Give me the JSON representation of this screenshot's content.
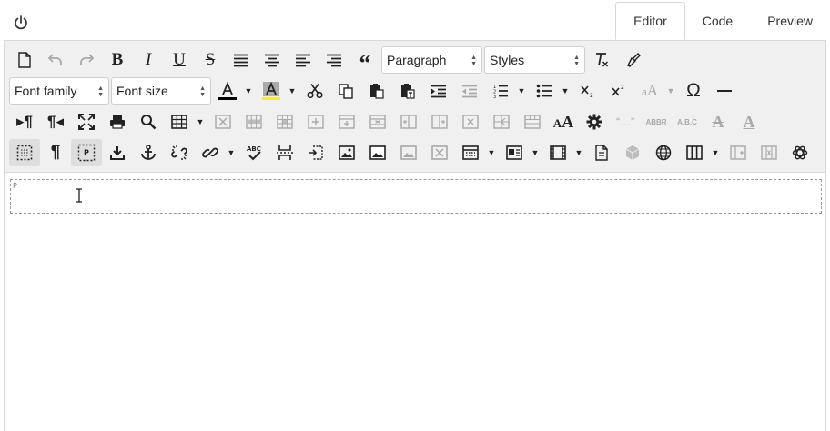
{
  "tabs": [
    {
      "label": "Editor",
      "active": true
    },
    {
      "label": "Code",
      "active": false
    },
    {
      "label": "Preview",
      "active": false
    }
  ],
  "toolbar": {
    "paragraph_select": "Paragraph",
    "styles_select": "Styles",
    "font_family_select": "Font family",
    "font_size_select": "Font size",
    "colors": {
      "text_color": "#000000",
      "highlight_color": "#f5e84a"
    }
  },
  "content": {
    "block_tag": "P"
  }
}
